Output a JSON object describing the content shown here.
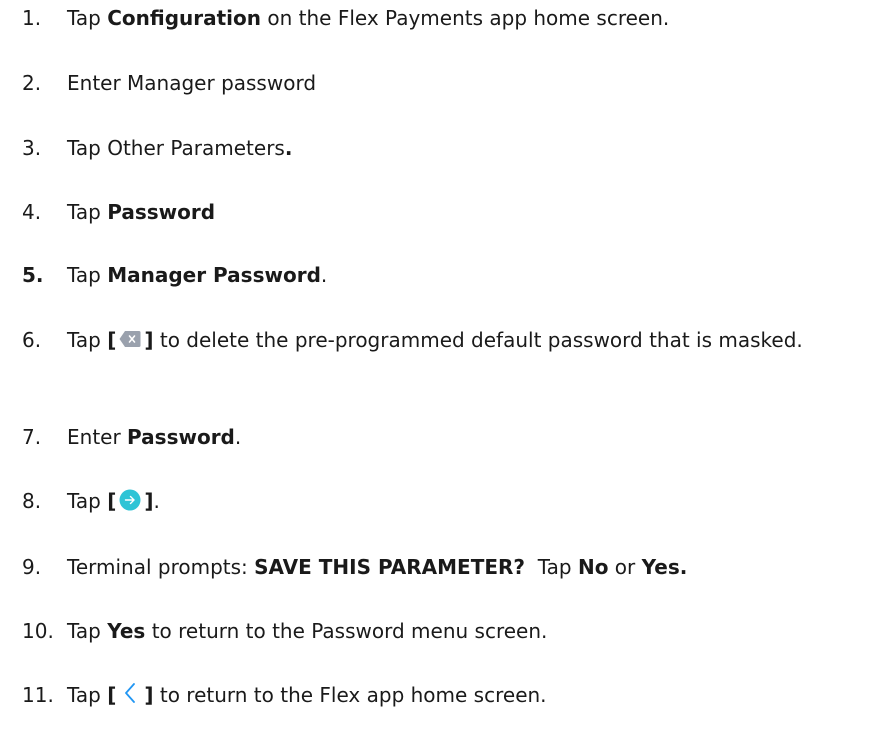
{
  "steps": [
    {
      "num": "1.",
      "parts": [
        {
          "t": "Tap ",
          "b": false
        },
        {
          "t": "Configuration",
          "b": true
        },
        {
          "t": " on the Flex Payments app home screen.",
          "b": false
        }
      ]
    },
    {
      "num": "2.",
      "parts": [
        {
          "t": "Enter Manager password",
          "b": false
        }
      ]
    },
    {
      "num": "3.",
      "parts": [
        {
          "t": "Tap Other Parameters",
          "b": false
        },
        {
          "t": ".",
          "b": true
        }
      ]
    },
    {
      "num": "4.",
      "parts": [
        {
          "t": "Tap ",
          "b": false
        },
        {
          "t": "Password",
          "b": true
        }
      ]
    },
    {
      "num": "5.",
      "num_bold": true,
      "parts": [
        {
          "t": "Tap ",
          "b": false
        },
        {
          "t": "Manager Password",
          "b": true
        },
        {
          "t": ".",
          "b": false
        }
      ]
    },
    {
      "num": "6.",
      "parts": [
        {
          "t": "Tap ",
          "b": false
        },
        {
          "t": "[",
          "b": true
        },
        {
          "icon": "backspace-icon"
        },
        {
          "t": "]",
          "b": true
        },
        {
          "t": " to delete the pre-programmed default password that is masked.",
          "b": false
        }
      ]
    },
    {
      "num": "7.",
      "parts": [
        {
          "t": "Enter ",
          "b": false
        },
        {
          "t": "Password",
          "b": true
        },
        {
          "t": ".",
          "b": false
        }
      ]
    },
    {
      "num": "8.",
      "parts": [
        {
          "t": "Tap ",
          "b": false
        },
        {
          "t": "[",
          "b": true
        },
        {
          "icon": "next-icon"
        },
        {
          "t": "]",
          "b": true
        },
        {
          "t": ".",
          "b": false
        }
      ]
    },
    {
      "num": "9.",
      "parts": [
        {
          "t": "Terminal prompts: ",
          "b": false
        },
        {
          "t": "SAVE THIS PARAMETER?",
          "b": true
        },
        {
          "t": "  Tap ",
          "b": false
        },
        {
          "t": "No",
          "b": true
        },
        {
          "t": " or ",
          "b": false
        },
        {
          "t": "Yes.",
          "b": true
        }
      ]
    },
    {
      "num": "10.",
      "parts": [
        {
          "t": "Tap ",
          "b": false
        },
        {
          "t": "Yes",
          "b": true
        },
        {
          "t": " to return to the Password menu screen.",
          "b": false
        }
      ]
    },
    {
      "num": "11.",
      "parts": [
        {
          "t": "Tap ",
          "b": false
        },
        {
          "t": "[",
          "b": true
        },
        {
          "icon": "back-icon"
        },
        {
          "t": "]",
          "b": true
        },
        {
          "t": " to return to the Flex app home screen.",
          "b": false
        }
      ]
    }
  ],
  "colors": {
    "text": "#1a1a1a",
    "backspace_icon": "#9aa1ad",
    "next_icon": "#2ec4d6",
    "back_icon": "#2196f3"
  }
}
